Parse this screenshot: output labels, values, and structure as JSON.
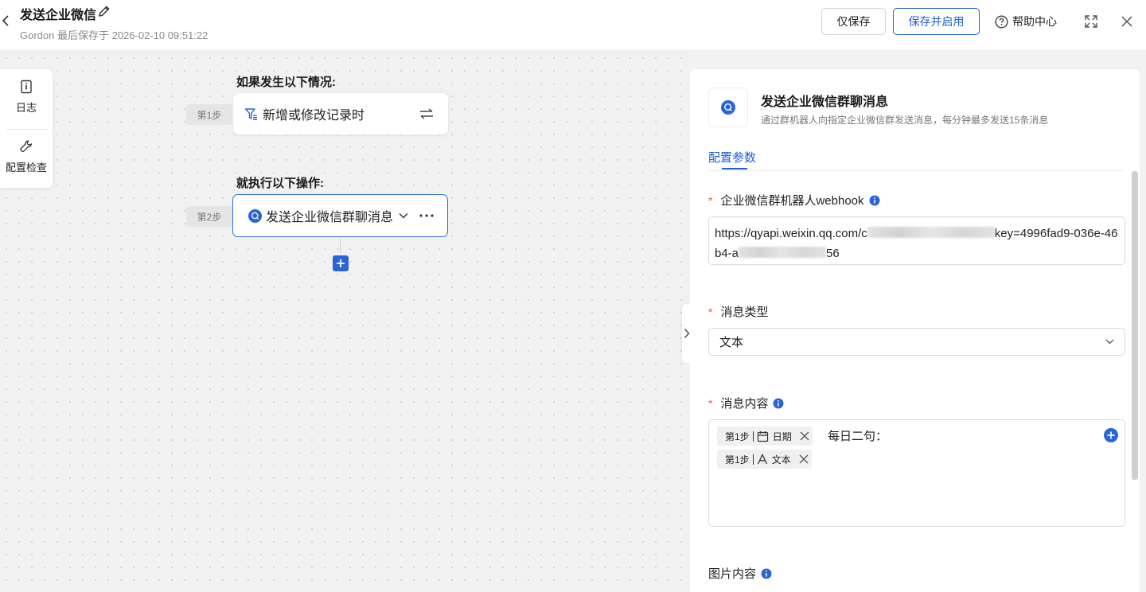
{
  "header": {
    "title": "发送企业微信",
    "subtitle": "Gordon 最后保存于 2026-02-10 09:51:22",
    "save_only_label": "仅保存",
    "save_enable_label": "保存并启用",
    "help_label": "帮助中心"
  },
  "tools": {
    "log_label": "日志",
    "config_check_label": "配置检查"
  },
  "flow": {
    "trigger_section": "如果发生以下情况:",
    "trigger_step": "第1步",
    "trigger_node": "新增或修改记录时",
    "action_section": "就执行以下操作:",
    "action_step": "第2步",
    "action_node": "发送企业微信群聊消息"
  },
  "panel": {
    "title": "发送企业微信群聊消息",
    "description": "通过群机器人向指定企业微信群发送消息，每分钟最多发送15条消息",
    "tab_config": "配置参数",
    "webhook_label": "企业微信群机器人webhook",
    "webhook_part1": "https://qyapi.weixin.qq.com/c",
    "webhook_part2": "key=4996fad9-036e-46b4-a",
    "webhook_part3": "56",
    "msg_type_label": "消息类型",
    "msg_type_value": "文本",
    "msg_content_label": "消息内容",
    "chip1_step": "第1步",
    "chip1_field": "日期",
    "content_text": "每日二句：",
    "chip2_step": "第1步",
    "chip2_field": "文本",
    "image_content_label": "图片内容"
  },
  "colors": {
    "primary": "#1f5fd1",
    "required": "#e5603b",
    "canvas": "#f1f1f1"
  }
}
